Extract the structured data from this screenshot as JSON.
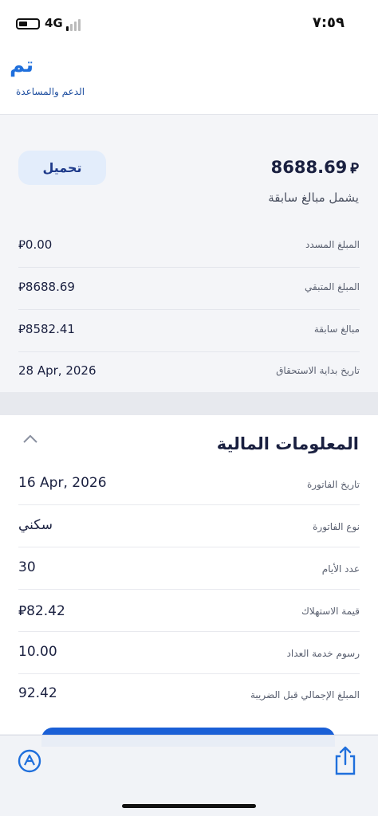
{
  "status_bar": {
    "network": "4G",
    "time": "٧:٥٩"
  },
  "header": {
    "done_label": "تم"
  },
  "cut_text": "الدعم والمساعدة",
  "summary": {
    "download_label": "تحميل",
    "total_amount": "8688.69",
    "currency_symbol": "⃁",
    "total_note": "يشمل مبالغ سابقة",
    "rows": [
      {
        "label": "المبلغ المسدد",
        "value": "0.00"
      },
      {
        "label": "المبلغ المتبقي",
        "value": "8688.69"
      },
      {
        "label": "مبالغ سابقة",
        "value": "8582.41"
      },
      {
        "label": "تاريخ بداية الاستحقاق",
        "value": "28 Apr, 2026"
      }
    ]
  },
  "financial_info": {
    "title": "المعلومات المالية",
    "rows": [
      {
        "label": "تاريخ الفاتورة",
        "value": "16 Apr, 2026"
      },
      {
        "label": "نوع الفاتورة",
        "value": "سكني"
      },
      {
        "label": "عدد الأيام",
        "value": "30"
      },
      {
        "label": "قيمة الاستهلاك",
        "value": "82.42"
      },
      {
        "label": "رسوم خدمة العداد",
        "value": "10.00"
      },
      {
        "label": "المبلغ الإجمالي قبل الضريبة",
        "value": "92.42"
      }
    ]
  },
  "colors": {
    "accent": "#1f6fdc",
    "dark_text": "#1a2040",
    "action_bar": "#1a5fd6"
  },
  "icons": {
    "toolbar_left": "markup-icon",
    "toolbar_right": "share-icon"
  }
}
